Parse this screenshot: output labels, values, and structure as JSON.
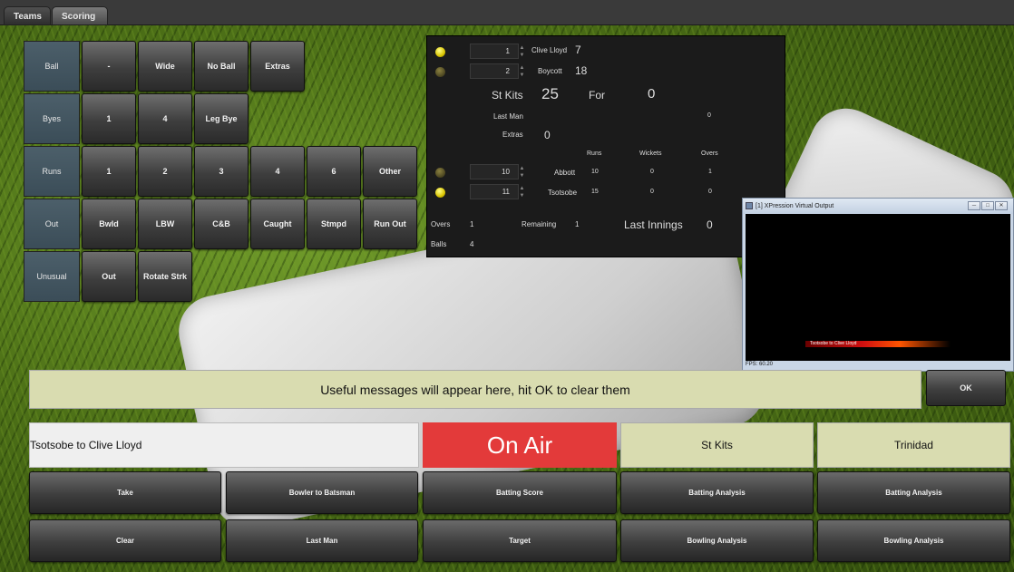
{
  "tabs": [
    "Teams",
    "Scoring"
  ],
  "grid": {
    "rows": [
      {
        "label": "Ball",
        "buttons": [
          "-",
          "Wide",
          "No Ball",
          "Extras"
        ]
      },
      {
        "label": "Byes",
        "buttons": [
          "1",
          "4",
          "Leg Bye"
        ]
      },
      {
        "label": "Runs",
        "buttons": [
          "1",
          "2",
          "3",
          "4",
          "6",
          "Other"
        ]
      },
      {
        "label": "Out",
        "buttons": [
          "Bwld",
          "LBW",
          "C&B",
          "Caught",
          "Stmpd",
          "Run Out"
        ]
      },
      {
        "label": "Unusual",
        "buttons": [
          "Out",
          "Rotate Strk"
        ]
      }
    ]
  },
  "scoreboard": {
    "batsman1": {
      "number": "1",
      "name": "Clive Lloyd",
      "runs": "7"
    },
    "batsman2": {
      "number": "2",
      "name": "Boycott",
      "runs": "18"
    },
    "team": "St Kits",
    "team_score": "25",
    "for_label": "For",
    "for_value": "0",
    "last_man_label": "Last Man",
    "last_man_value": "0",
    "extras_label": "Extras",
    "extras_value": "0",
    "bowl_headers": [
      "Runs",
      "Wickets",
      "Overs"
    ],
    "bowler1": {
      "number": "10",
      "name": "Abbott",
      "runs": "10",
      "wickets": "0",
      "overs": "1"
    },
    "bowler2": {
      "number": "11",
      "name": "Tsotsobe",
      "runs": "15",
      "wickets": "0",
      "overs": "0"
    },
    "overs_label": "Overs",
    "overs_value": "1",
    "remaining_label": "Remaining",
    "remaining_value": "1",
    "last_innings_label": "Last Innings",
    "last_innings_value": "0",
    "balls_label": "Balls",
    "balls_value": "4"
  },
  "xpression": {
    "title": "[1] XPression Virtual Output",
    "lower_third": "Tsotsobe to Clive Lloyd",
    "fps": "FPS: 60.20"
  },
  "message": "Useful messages will appear here, hit OK to clear them",
  "ok_label": "OK",
  "caption": "Tsotsobe to Clive Lloyd",
  "on_air": "On Air",
  "team_left": "St Kits",
  "team_right": "Trinidad",
  "row1": [
    "Take",
    "Bowler to Batsman",
    "Batting Score",
    "Batting Analysis",
    "Batting Analysis"
  ],
  "row2": [
    "Clear",
    "Last Man",
    "Target",
    "Bowling Analysis",
    "Bowling Analysis"
  ],
  "colors": {
    "on_air": "#e33a3a",
    "message_bg": "#d9dcb0",
    "lamp_on": "#d9c400"
  }
}
